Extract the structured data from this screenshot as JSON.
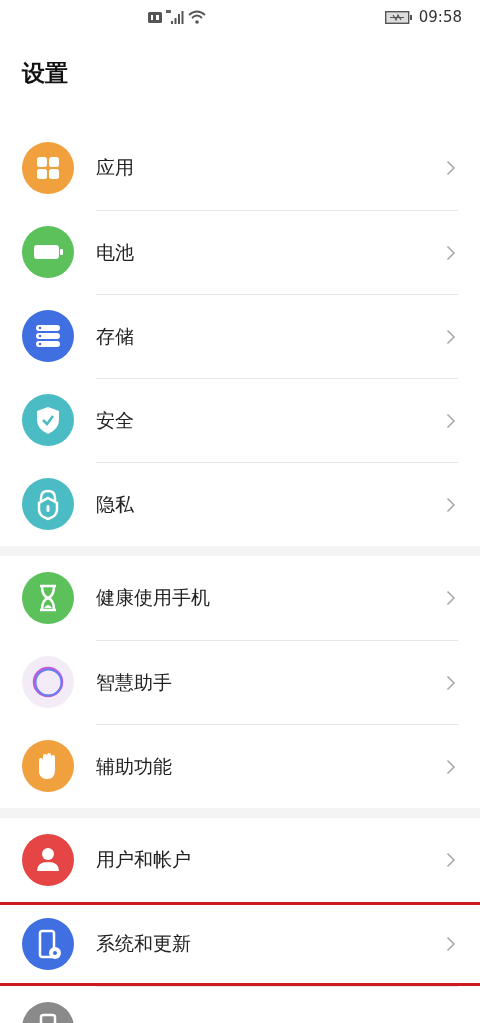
{
  "status_bar": {
    "time": "09:58"
  },
  "title": "设置",
  "groups": [
    {
      "items": [
        {
          "label": "应用",
          "kind": "apps",
          "color": "#f0a03c",
          "highlighted": false
        },
        {
          "label": "电池",
          "kind": "battery",
          "color": "#5cc15a",
          "highlighted": false
        },
        {
          "label": "存储",
          "kind": "storage",
          "color": "#3f6fe0",
          "highlighted": false
        },
        {
          "label": "安全",
          "kind": "shield",
          "color": "#4bbcc4",
          "highlighted": false
        },
        {
          "label": "隐私",
          "kind": "lock",
          "color": "#4bbcc4",
          "highlighted": false
        }
      ]
    },
    {
      "items": [
        {
          "label": "健康使用手机",
          "kind": "hourglass",
          "color": "#5cc15a",
          "highlighted": false
        },
        {
          "label": "智慧助手",
          "kind": "ring",
          "color": "#f3ecf7",
          "highlighted": false
        },
        {
          "label": "辅助功能",
          "kind": "hand",
          "color": "#f0a03c",
          "highlighted": false
        }
      ]
    },
    {
      "items": [
        {
          "label": "用户和帐户",
          "kind": "user",
          "color": "#e54545",
          "highlighted": false
        },
        {
          "label": "系统和更新",
          "kind": "phone-gear",
          "color": "#3f6fe0",
          "highlighted": true
        },
        {
          "kind": "phone",
          "color": "#8a8a8a",
          "highlighted": false
        }
      ]
    }
  ]
}
